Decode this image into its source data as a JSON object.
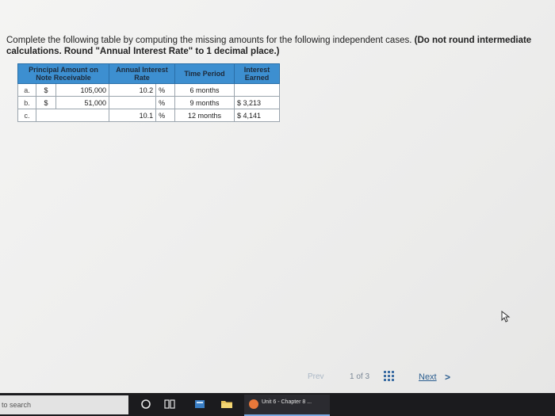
{
  "instructions": {
    "text_plain": "Complete the following table by computing the missing amounts for the following independent cases. ",
    "text_bold": "(Do not round intermediate calculations. Round \"Annual Interest Rate\" to 1 decimal place.)"
  },
  "table": {
    "headers": {
      "principal": "Principal Amount on Note Receivable",
      "rate": "Annual Interest Rate",
      "time": "Time Period",
      "interest": "Interest Earned"
    },
    "rows": [
      {
        "label": "a.",
        "dollar": "$",
        "principal": "105,000",
        "rate": "10.2",
        "pct": "%",
        "time": "6 months",
        "interest": ""
      },
      {
        "label": "b.",
        "dollar": "$",
        "principal": "51,000",
        "rate": "",
        "pct": "%",
        "time": "9 months",
        "interest": "$ 3,213"
      },
      {
        "label": "c.",
        "dollar": "",
        "principal": "",
        "rate": "10.1",
        "pct": "%",
        "time": "12 months",
        "interest": "$ 4,141"
      }
    ]
  },
  "pager": {
    "prev_label": "Prev",
    "page_info": "1 of 3",
    "next_label": "Next",
    "next_arrow": ">"
  },
  "taskbar": {
    "search_placeholder": "to search",
    "active_app_label": "Unit 6 - Chapter 8 ..."
  },
  "icons": {
    "cortana": "circle-icon",
    "task_view": "task-view-icon",
    "app1": "app-icon",
    "file_explorer": "folder-icon",
    "browser": "browser-icon",
    "grid": "grid-icon",
    "cursor": "mouse-cursor-icon"
  },
  "colors": {
    "header_bg": "#3d8fd0",
    "input_border": "#2f7fc1",
    "taskbar_bg": "#1b1b1e",
    "next_link": "#2a5d8f"
  }
}
